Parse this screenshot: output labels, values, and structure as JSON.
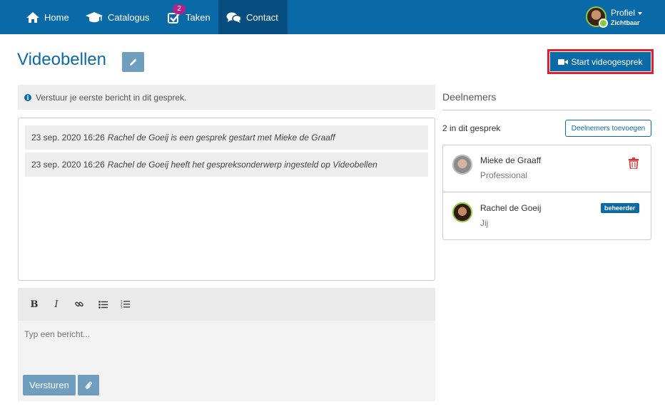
{
  "nav": {
    "home": "Home",
    "catalogus": "Catalogus",
    "taken": "Taken",
    "taken_badge": "2",
    "contact": "Contact",
    "profile_name": "Profiel",
    "profile_status": "Zichtbaar"
  },
  "page": {
    "title": "Videobellen",
    "start_button": "Start videogesprek"
  },
  "info": {
    "text": "Verstuur je eerste bericht in dit gesprek."
  },
  "log": [
    {
      "time": "23 sep. 2020 16:26",
      "message": "Rachel de Goeij is een gesprek gestart met Mieke de Graaff"
    },
    {
      "time": "23 sep. 2020 16:26",
      "message": "Rachel de Goeij heeft het gespreksonderwerp ingesteld op Videobellen"
    }
  ],
  "editor": {
    "placeholder": "Typ een bericht...",
    "send": "Versturen",
    "bold": "B",
    "italic": "I"
  },
  "participants": {
    "heading": "Deelnemers",
    "count": "2 in dit gesprek",
    "add_button": "Deelnemers toevoegen",
    "items": [
      {
        "name": "Mieke de Graaff",
        "role": "Professional"
      },
      {
        "name": "Rachel de Goeij",
        "role": "Jij",
        "badge": "beheerder"
      }
    ]
  },
  "colors": {
    "brand": "#0a6aa8",
    "highlight": "#e0202e",
    "badge": "#b5218a"
  }
}
